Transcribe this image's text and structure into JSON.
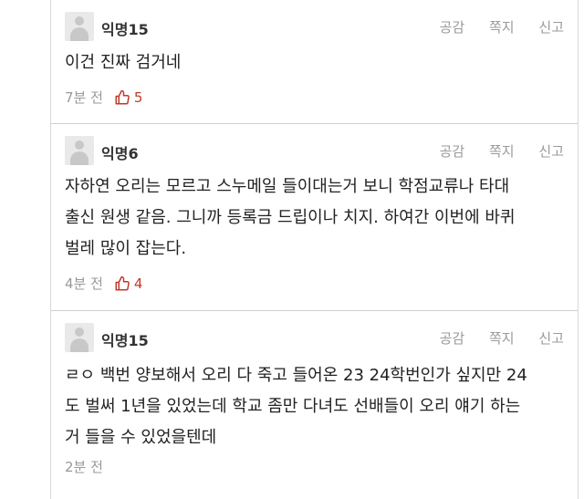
{
  "actions": {
    "like": "공감",
    "message": "쪽지",
    "report": "신고"
  },
  "comments": [
    {
      "author": "익명15",
      "lines": [
        "이건 진짜 검거네"
      ],
      "time": "7분 전",
      "likes": "5"
    },
    {
      "author": "익명6",
      "lines": [
        "자하연 오리는 모르고 스누메일 들이대는거 보니 학점교류나 타대",
        "출신 원생 같음. 그니까 등록금 드립이나 치지. 하여간 이번에 바퀴",
        "벌레 많이 잡는다."
      ],
      "time": "4분 전",
      "likes": "4"
    },
    {
      "author": "익명15",
      "lines": [
        "ㄹㅇ 백번 양보해서 오리 다 죽고 들어온 23 24학번인가 싶지만 24",
        "도 벌써 1년을 있었는데 학교 좀만 다녀도 선배들이 오리 얘기 하는",
        "거 들을 수 있었을텐데"
      ],
      "time": "2분 전",
      "likes": ""
    }
  ],
  "colors": {
    "like": "#c0392b",
    "muted": "#999999"
  },
  "icons": {
    "avatar": "anonymous-avatar-icon",
    "like": "thumbs-up-icon"
  }
}
